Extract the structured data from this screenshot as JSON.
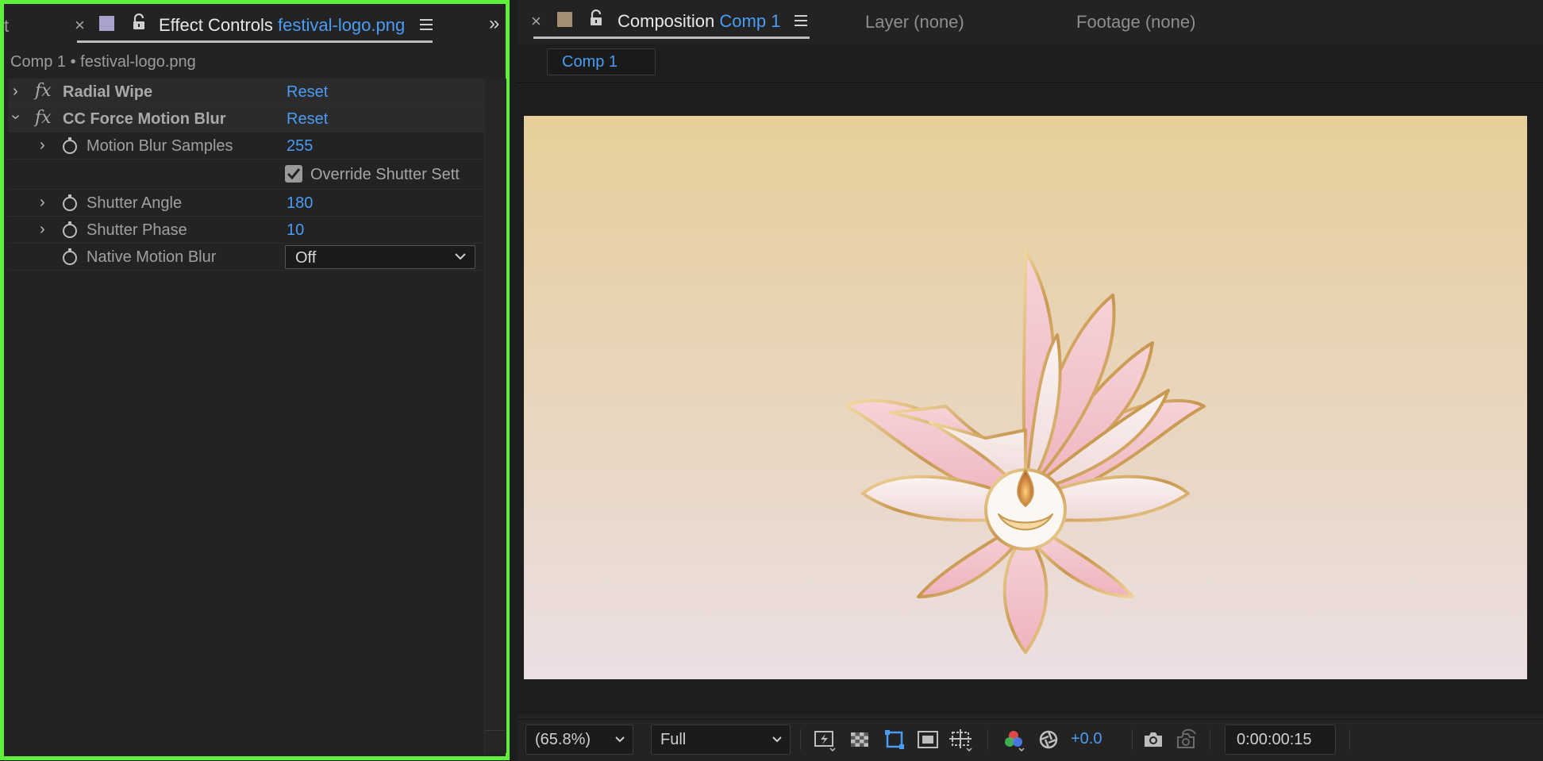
{
  "effect_controls_panel": {
    "cut_tab_label": "t",
    "title_label": "Effect Controls",
    "layer_name": "festival-logo.png",
    "layer_path": "Comp 1 • festival-logo.png",
    "effects": [
      {
        "name": "Radial Wipe",
        "reset_label": "Reset",
        "expanded": false
      },
      {
        "name": "CC Force Motion Blur",
        "reset_label": "Reset",
        "expanded": true
      }
    ],
    "properties": [
      {
        "name": "Motion Blur Samples",
        "value": "255"
      },
      {
        "checkbox_label": "Override Shutter Sett",
        "checked": true
      },
      {
        "name": "Shutter Angle",
        "value": "180"
      },
      {
        "name": "Shutter Phase",
        "value": "10"
      },
      {
        "name": "Native Motion Blur",
        "dropdown_value": "Off"
      }
    ]
  },
  "composition_panel": {
    "title_label": "Composition",
    "comp_name": "Comp 1",
    "layer_tab": "Layer (none)",
    "footage_tab": "Footage (none)",
    "flowchart_chip": "Comp 1",
    "footer": {
      "magnification": "(65.8%)",
      "resolution": "Full",
      "exposure": "+0.0",
      "timecode": "0:00:00:15"
    }
  },
  "colors": {
    "highlight_border": "#5ef03a",
    "accent_blue": "#4a9cf5",
    "effect_controls_swatch": "#a9a3cc",
    "composition_swatch": "#a48f73",
    "comp_bg_top": "#e6cf9a",
    "comp_bg_bottom": "#ecdfe3"
  },
  "icons": [
    "close-icon",
    "lock-icon",
    "hamburger-menu-icon",
    "panel-overflow-icon",
    "twirl-chevron-icon",
    "fx-icon",
    "stopwatch-icon",
    "checkmark-icon",
    "fast-previews-icon",
    "transparency-grid-icon",
    "region-of-interest-icon",
    "mask-visibility-icon",
    "guides-grid-icon",
    "color-channels-icon",
    "reset-exposure-icon",
    "snapshot-icon",
    "show-snapshot-icon"
  ]
}
